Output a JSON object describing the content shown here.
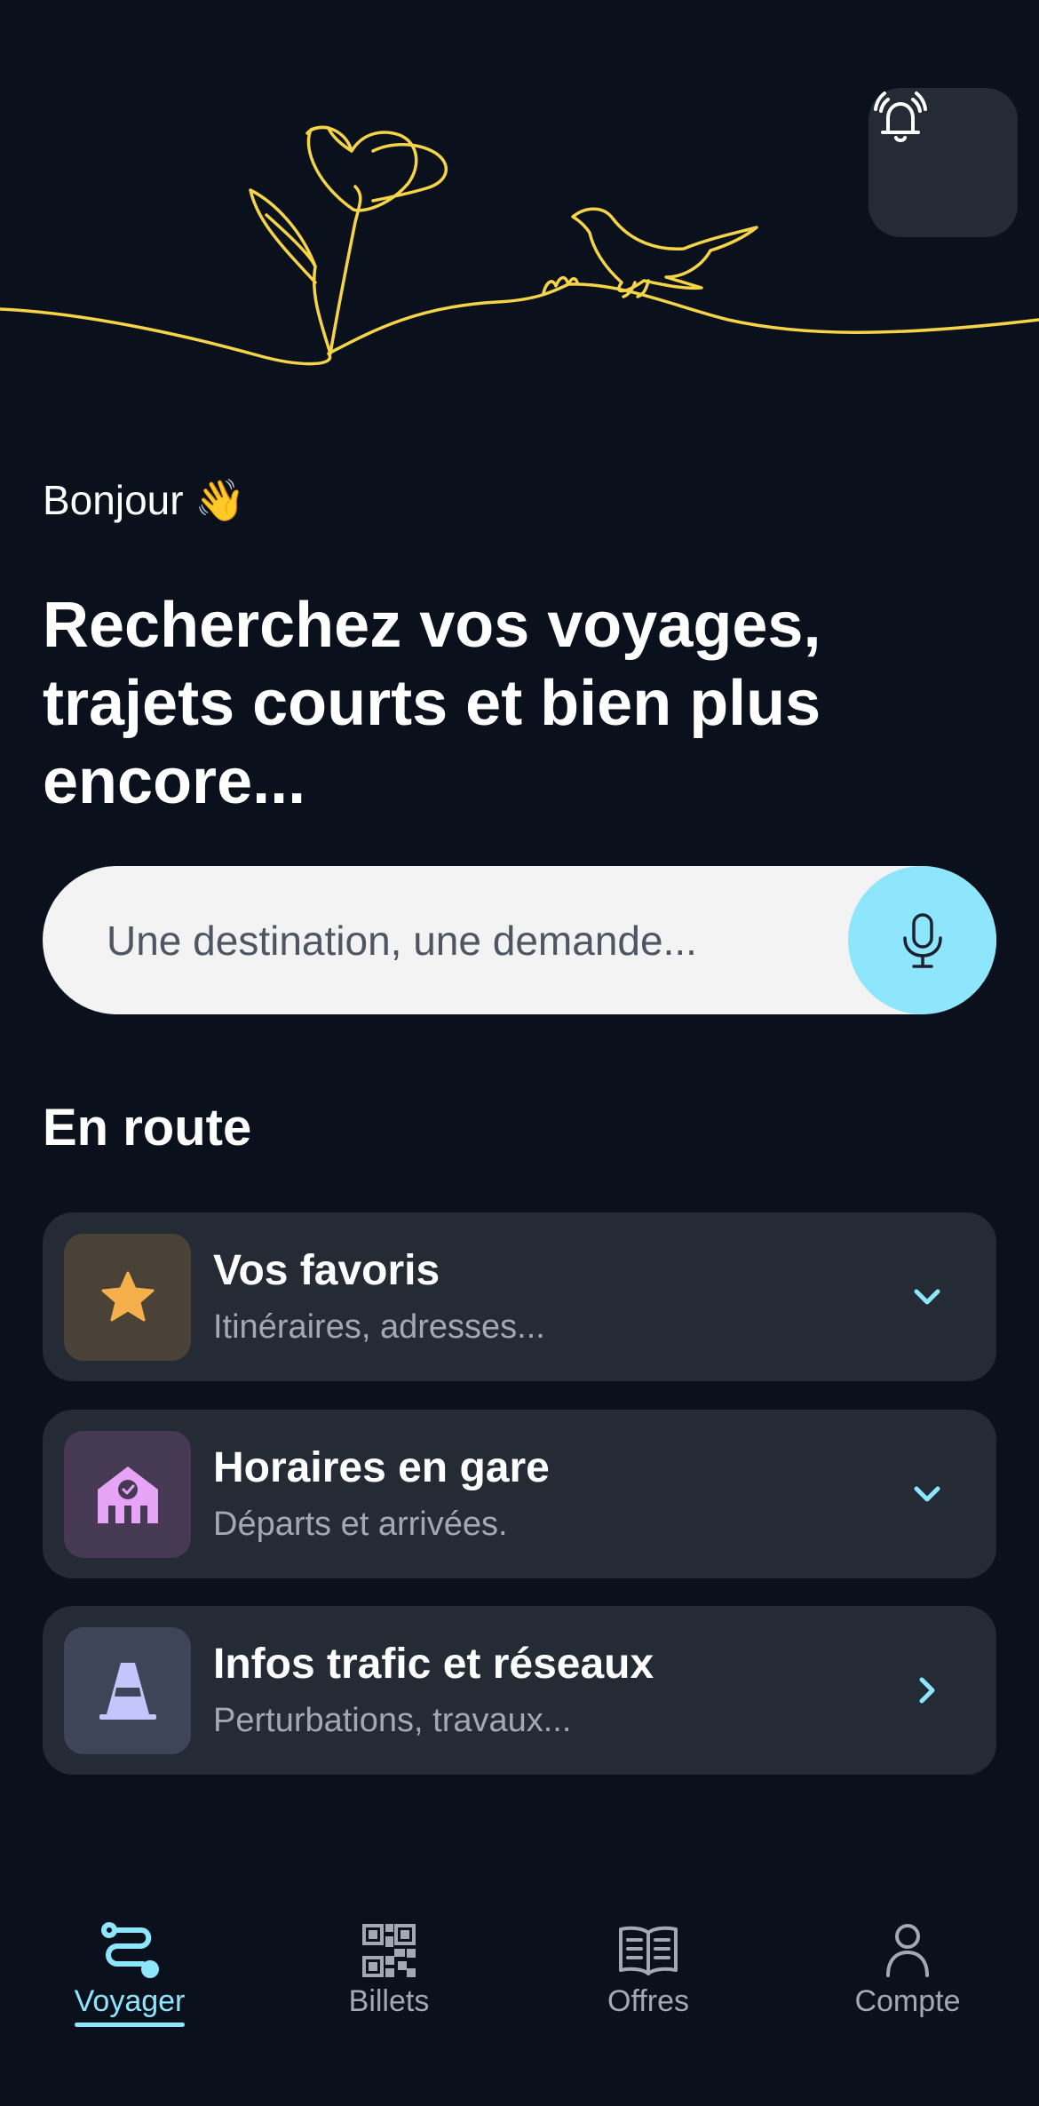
{
  "header": {
    "illustration": "flower-and-bird-line-art",
    "illustration_color": "#f5d547",
    "bell_icon": "alarm-bell-icon"
  },
  "greeting": "Bonjour 👋",
  "headline": "Recherchez vos voyages, trajets courts et bien plus encore...",
  "search": {
    "placeholder": "Une destination, une demande...",
    "mic_icon": "microphone-icon",
    "accent": "#8ee6fd"
  },
  "section": {
    "title": "En route"
  },
  "cards": [
    {
      "title": "Vos favoris",
      "subtitle": "Itinéraires, adresses...",
      "icon": "star-icon",
      "icon_color": "#f5b04c",
      "icon_bg": "#4a4236",
      "chevron": "chevron-down-icon"
    },
    {
      "title": "Horaires en gare",
      "subtitle": "Départs et arrivées.",
      "icon": "station-clock-icon",
      "icon_color": "#e7a3f5",
      "icon_bg": "#463953",
      "chevron": "chevron-down-icon"
    },
    {
      "title": "Infos trafic et réseaux",
      "subtitle": "Perturbations, travaux...",
      "icon": "traffic-cone-icon",
      "icon_color": "#c3c5fb",
      "icon_bg": "#3e4558",
      "chevron": "chevron-right-icon"
    }
  ],
  "tabbar": {
    "tabs": [
      {
        "label": "Voyager",
        "icon": "route-icon",
        "active": true
      },
      {
        "label": "Billets",
        "icon": "qr-code-icon",
        "active": false
      },
      {
        "label": "Offres",
        "icon": "open-book-icon",
        "active": false
      },
      {
        "label": "Compte",
        "icon": "user-icon",
        "active": false
      }
    ],
    "active_color": "#8ee6fd",
    "inactive_color": "#a3a9b3"
  }
}
